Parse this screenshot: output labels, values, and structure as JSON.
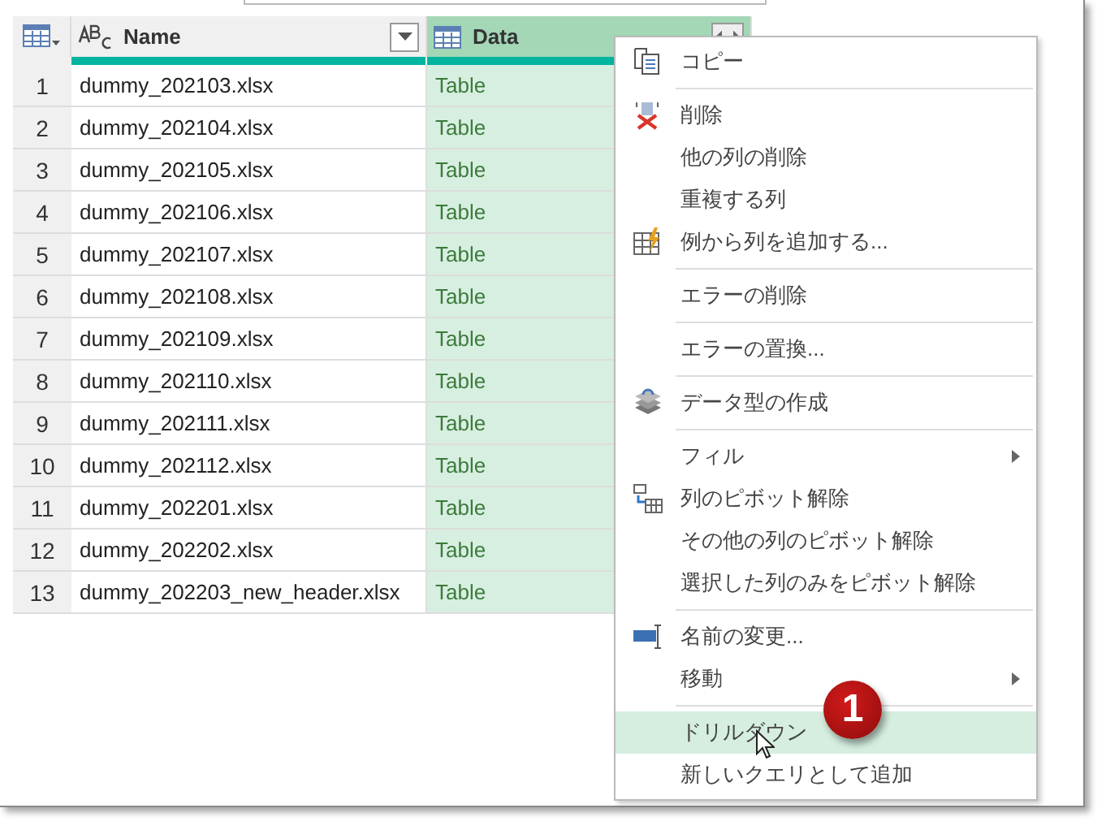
{
  "table": {
    "columns": [
      {
        "label": "Name",
        "selected": false
      },
      {
        "label": "Data",
        "selected": true
      }
    ],
    "rows": [
      {
        "number": "1",
        "name": "dummy_202103.xlsx",
        "data": "Table"
      },
      {
        "number": "2",
        "name": "dummy_202104.xlsx",
        "data": "Table"
      },
      {
        "number": "3",
        "name": "dummy_202105.xlsx",
        "data": "Table"
      },
      {
        "number": "4",
        "name": "dummy_202106.xlsx",
        "data": "Table"
      },
      {
        "number": "5",
        "name": "dummy_202107.xlsx",
        "data": "Table"
      },
      {
        "number": "6",
        "name": "dummy_202108.xlsx",
        "data": "Table"
      },
      {
        "number": "7",
        "name": "dummy_202109.xlsx",
        "data": "Table"
      },
      {
        "number": "8",
        "name": "dummy_202110.xlsx",
        "data": "Table"
      },
      {
        "number": "9",
        "name": "dummy_202111.xlsx",
        "data": "Table"
      },
      {
        "number": "10",
        "name": "dummy_202112.xlsx",
        "data": "Table"
      },
      {
        "number": "11",
        "name": "dummy_202201.xlsx",
        "data": "Table"
      },
      {
        "number": "12",
        "name": "dummy_202202.xlsx",
        "data": "Table"
      },
      {
        "number": "13",
        "name": "dummy_202203_new_header.xlsx",
        "data": "Table"
      }
    ]
  },
  "context_menu": {
    "groups": [
      [
        {
          "label": "コピー",
          "submenu": false,
          "selected": false
        }
      ],
      [
        {
          "label": "削除",
          "submenu": false,
          "selected": false
        },
        {
          "label": "他の列の削除",
          "submenu": false,
          "selected": false
        },
        {
          "label": "重複する列",
          "submenu": false,
          "selected": false
        },
        {
          "label": "例から列を追加する...",
          "submenu": false,
          "selected": false
        }
      ],
      [
        {
          "label": "エラーの削除",
          "submenu": false,
          "selected": false
        }
      ],
      [
        {
          "label": "エラーの置換...",
          "submenu": false,
          "selected": false
        }
      ],
      [
        {
          "label": "データ型の作成",
          "submenu": false,
          "selected": false
        }
      ],
      [
        {
          "label": "フィル",
          "submenu": true,
          "selected": false
        },
        {
          "label": "列のピボット解除",
          "submenu": false,
          "selected": false
        },
        {
          "label": "その他の列のピボット解除",
          "submenu": false,
          "selected": false
        },
        {
          "label": "選択した列のみをピボット解除",
          "submenu": false,
          "selected": false
        }
      ],
      [
        {
          "label": "名前の変更...",
          "submenu": false,
          "selected": false
        },
        {
          "label": "移動",
          "submenu": true,
          "selected": false
        }
      ],
      [
        {
          "label": "ドリルダウン",
          "submenu": false,
          "selected": true
        },
        {
          "label": "新しいクエリとして追加",
          "submenu": false,
          "selected": false
        }
      ]
    ]
  },
  "callout": "1"
}
